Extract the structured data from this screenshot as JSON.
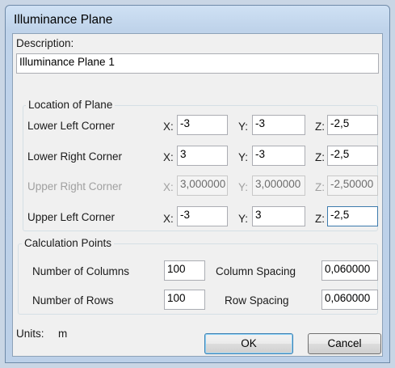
{
  "window": {
    "title": "Illuminance Plane"
  },
  "description": {
    "label": "Description:",
    "value": "Illuminance Plane 1"
  },
  "location": {
    "group_label": "Location of Plane",
    "x_label": "X:",
    "y_label": "Y:",
    "z_label": "Z:",
    "rows": [
      {
        "label": "Lower Left Corner",
        "x": "-3",
        "y": "-3",
        "z": "-2,5",
        "enabled": true
      },
      {
        "label": "Lower Right Corner",
        "x": "3",
        "y": "-3",
        "z": "-2,5",
        "enabled": true
      },
      {
        "label": "Upper Right Corner",
        "x": "3,000000",
        "y": "3,000000",
        "z": "-2,50000",
        "enabled": false
      },
      {
        "label": "Upper Left Corner",
        "x": "-3",
        "y": "3",
        "z": "-2,5",
        "enabled": true
      }
    ]
  },
  "calc": {
    "group_label": "Calculation Points",
    "columns_label": "Number of Columns",
    "columns_value": "100",
    "col_spacing_label": "Column Spacing",
    "col_spacing_value": "0,060000",
    "rows_label": "Number of Rows",
    "rows_value": "100",
    "row_spacing_label": "Row Spacing",
    "row_spacing_value": "0,060000"
  },
  "footer": {
    "units_label": "Units:",
    "units_value": "m",
    "ok": "OK",
    "cancel": "Cancel"
  }
}
